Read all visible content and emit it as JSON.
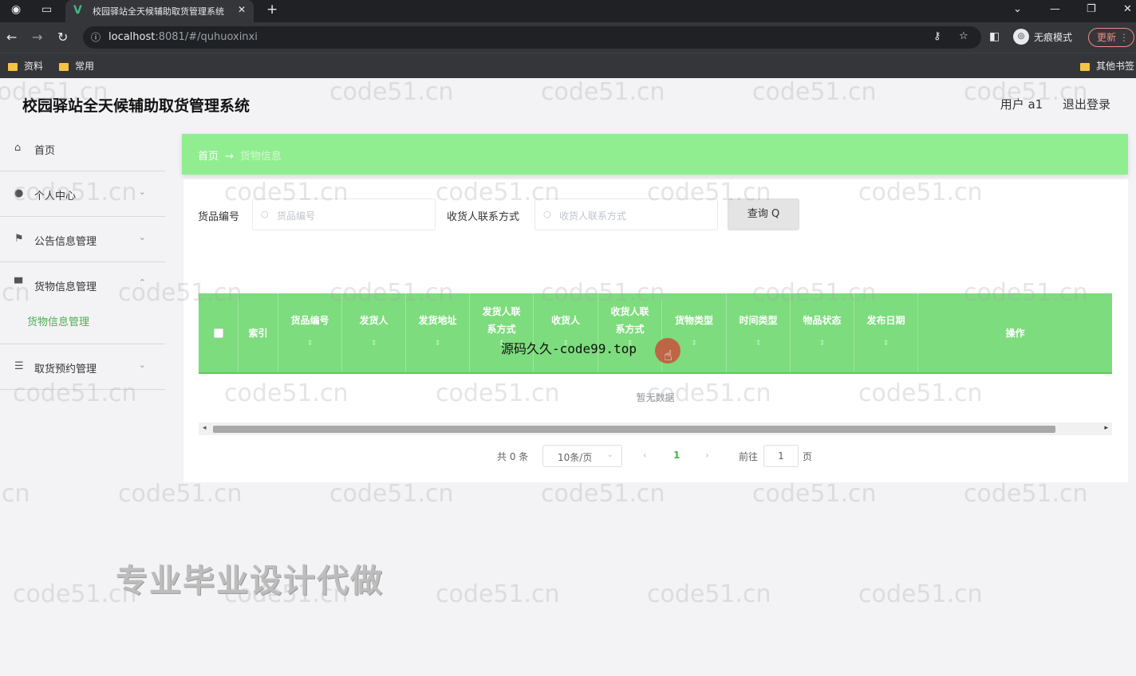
{
  "browser": {
    "tab_title": "校园驿站全天候辅助取货管理系统",
    "url_host": "localhost",
    "url_rest": ":8081/#/quhuoxinxi",
    "incognito_label": "无痕模式",
    "update_label": "更新",
    "bookmarks": [
      "资料",
      "常用"
    ],
    "other_bookmarks": "其他书签",
    "tab_close": "✕",
    "new_tab": "+"
  },
  "app": {
    "title": "校园驿站全天候辅助取货管理系统",
    "user_label": "用户 a1",
    "logout_label": "退出登录"
  },
  "sidebar": {
    "items": [
      {
        "label": "首页",
        "icon": "home-icon"
      },
      {
        "label": "个人中心",
        "icon": "user-icon"
      },
      {
        "label": "公告信息管理",
        "icon": "flag-icon"
      },
      {
        "label": "货物信息管理",
        "icon": "cargo-icon"
      },
      {
        "label": "取货预约管理",
        "icon": "list-icon"
      }
    ],
    "submenu_label": "货物信息管理"
  },
  "breadcrumb": {
    "home": "首页",
    "arrow": "→",
    "current": "货物信息"
  },
  "search": {
    "field1_label": "货品编号",
    "field1_placeholder": "货品编号",
    "field2_label": "收货人联系方式",
    "field2_placeholder": "收货人联系方式",
    "query_label": "查询 Q"
  },
  "table": {
    "columns": [
      {
        "label": "索引"
      },
      {
        "label": "货品编号"
      },
      {
        "label": "发货人"
      },
      {
        "label": "发货地址"
      },
      {
        "label": "发货人联系方式"
      },
      {
        "label": "收货人"
      },
      {
        "label": "收货人联系方式"
      },
      {
        "label": "货物类型"
      },
      {
        "label": "时间类型"
      },
      {
        "label": "物品状态"
      },
      {
        "label": "发布日期"
      },
      {
        "label": "操作"
      }
    ],
    "sort_mark": "↕",
    "empty_text": "暂无数据"
  },
  "pagination": {
    "total": "共 0 条",
    "page_size": "10条/页",
    "current_page": "1",
    "goto_prefix": "前往",
    "goto_value": "1",
    "goto_suffix": "页"
  },
  "overlay": {
    "source_text": "源码久久-code99.top",
    "promo": "专业毕业设计代做",
    "watermark": "code51.cn"
  },
  "colors": {
    "accent_green": "#90ee90",
    "header_green": "#7ddc7d",
    "active_green": "#4caf50"
  }
}
